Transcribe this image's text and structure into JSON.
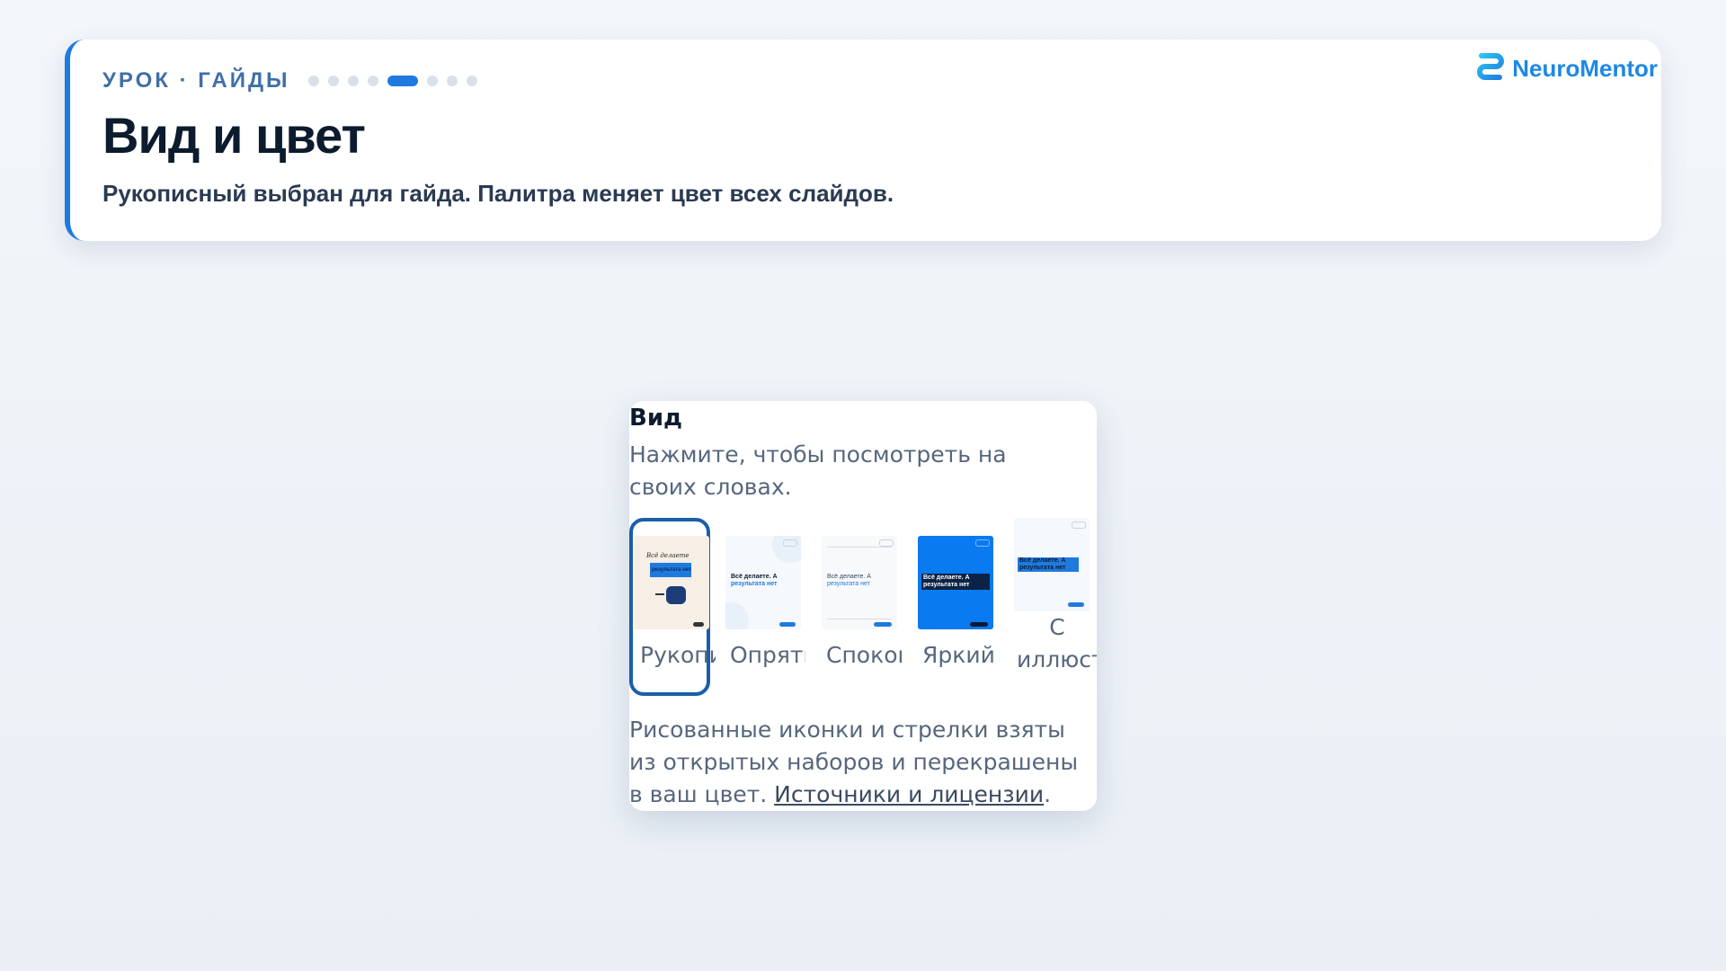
{
  "header": {
    "eyebrow": "УРОК · ГАЙДЫ",
    "progress": {
      "total": 8,
      "current": 5
    },
    "title": "Вид и цвет",
    "subtitle": "Рукописный выбран для гайда. Палитра меняет цвет всех слайдов.",
    "brand_name": "NeuroMentor"
  },
  "panel": {
    "title": "Вид",
    "hint": "Нажмите, чтобы посмотреть на своих словах.",
    "options": [
      {
        "label": "Рукописный",
        "selected": true,
        "preview_text": "Всё делаете",
        "preview_highlight": "результата нет"
      },
      {
        "label": "Опрятный",
        "selected": false,
        "preview_text": "Всё делаете. А",
        "preview_highlight": "результата нет"
      },
      {
        "label": "Спокойный",
        "selected": false,
        "preview_text": "Всё делаете. А",
        "preview_highlight": "результата нет"
      },
      {
        "label": "Яркий",
        "selected": false,
        "preview_text": "Всё делаете. А",
        "preview_highlight": "результата нет"
      },
      {
        "label": "С иллюстрациями",
        "selected": false,
        "preview_text": "Всё делаете. А",
        "preview_highlight": "результата нет"
      }
    ],
    "footer_text": "Рисованные иконки и стрелки взяты из открытых наборов и перекрашены в ваш цвет. ",
    "footer_link": "Источники и лицензии",
    "footer_end": "."
  },
  "colors": {
    "accent": "#1f7ae0",
    "selected_border": "#1a5fa8",
    "bright_bg": "#0a7af0",
    "handwritten_bg": "#f7efe6"
  }
}
